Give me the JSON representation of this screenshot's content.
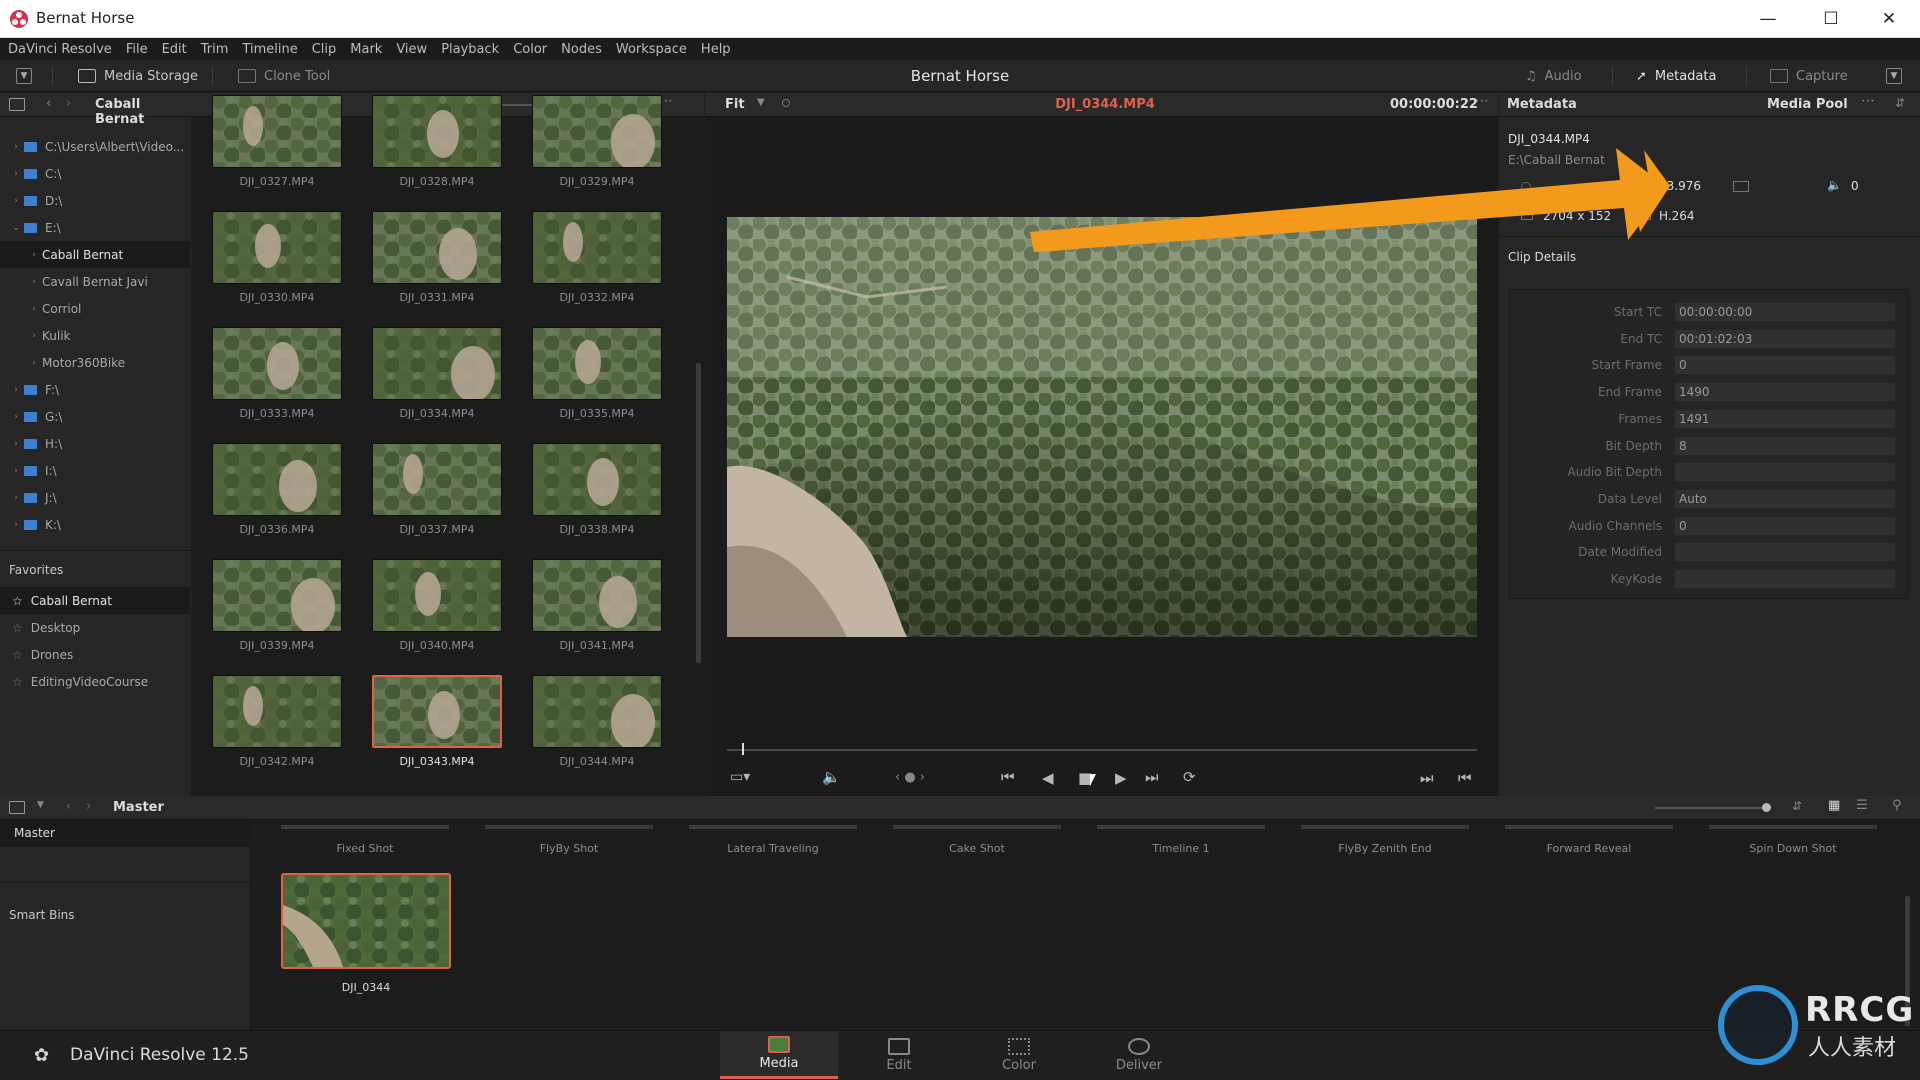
{
  "window": {
    "title": "Bernat Horse"
  },
  "menu": [
    "DaVinci Resolve",
    "File",
    "Edit",
    "Trim",
    "Timeline",
    "Clip",
    "Mark",
    "View",
    "Playback",
    "Color",
    "Nodes",
    "Workspace",
    "Help"
  ],
  "toolbar": {
    "media_storage": "Media Storage",
    "clone_tool": "Clone Tool",
    "project": "Bernat Horse",
    "audio": "Audio",
    "metadata": "Metadata",
    "capture": "Capture"
  },
  "browser": {
    "folder": "Caball Bernat",
    "tree": [
      {
        "label": "C:\\Users\\Albert\\Video...",
        "type": "drive"
      },
      {
        "label": "C:\\",
        "type": "drive"
      },
      {
        "label": "D:\\",
        "type": "drive"
      },
      {
        "label": "E:\\",
        "type": "drive",
        "open": true
      },
      {
        "label": "Caball Bernat",
        "type": "folder",
        "selected": true
      },
      {
        "label": "Cavall Bernat Javi",
        "type": "folder"
      },
      {
        "label": "Corriol",
        "type": "folder"
      },
      {
        "label": "Kulik",
        "type": "folder"
      },
      {
        "label": "Motor360Bike",
        "type": "folder"
      },
      {
        "label": "F:\\",
        "type": "drive"
      },
      {
        "label": "G:\\",
        "type": "drive"
      },
      {
        "label": "H:\\",
        "type": "drive"
      },
      {
        "label": "I:\\",
        "type": "drive"
      },
      {
        "label": "J:\\",
        "type": "drive"
      },
      {
        "label": "K:\\",
        "type": "drive"
      }
    ],
    "favorites_title": "Favorites",
    "favorites": [
      "Caball Bernat",
      "Desktop",
      "Drones",
      "EditingVideoCourse"
    ],
    "clips": [
      "DJI_0327.MP4",
      "DJI_0328.MP4",
      "DJI_0329.MP4",
      "DJI_0330.MP4",
      "DJI_0331.MP4",
      "DJI_0332.MP4",
      "DJI_0333.MP4",
      "DJI_0334.MP4",
      "DJI_0335.MP4",
      "DJI_0336.MP4",
      "DJI_0337.MP4",
      "DJI_0338.MP4",
      "DJI_0339.MP4",
      "DJI_0340.MP4",
      "DJI_0341.MP4",
      "DJI_0342.MP4",
      "DJI_0343.MP4",
      "DJI_0344.MP4"
    ],
    "selected_clip": "DJI_0343.MP4"
  },
  "viewer": {
    "zoom": "Fit",
    "clip_name": "DJI_0344.MP4",
    "timecode": "00:00:00:22",
    "playhead": 0.02
  },
  "metadata": {
    "title": "Metadata",
    "media_pool_tab": "Media Pool",
    "file": "DJI_0344.MP4",
    "path": "E:\\Caball Bernat",
    "fps": "23.976",
    "resolution": "2704 x 152",
    "codec": "H.264",
    "audio_ch": "0",
    "section": "Clip Details",
    "fields": [
      {
        "label": "Start TC",
        "value": "00:00:00:00"
      },
      {
        "label": "End TC",
        "value": "00:01:02:03"
      },
      {
        "label": "Start Frame",
        "value": "0"
      },
      {
        "label": "End Frame",
        "value": "1490"
      },
      {
        "label": "Frames",
        "value": "1491"
      },
      {
        "label": "Bit Depth",
        "value": "8"
      },
      {
        "label": "Audio Bit Depth",
        "value": ""
      },
      {
        "label": "Data Level",
        "value": "Auto"
      },
      {
        "label": "Audio Channels",
        "value": "0"
      },
      {
        "label": "Date Modified",
        "value": ""
      },
      {
        "label": "KeyKode",
        "value": ""
      }
    ]
  },
  "media_pool": {
    "bin": "Master",
    "bins": [
      "Master"
    ],
    "smart_bins": "Smart Bins",
    "bin_items": [
      "Fixed Shot",
      "FlyBy Shot",
      "Lateral Traveling",
      "Cake Shot",
      "Timeline 1",
      "FlyBy Zenith End",
      "Forward Reveal",
      "Spin Down Shot"
    ],
    "clip": "DJI_0344"
  },
  "app": {
    "name": "DaVinci Resolve 12.5"
  },
  "pages": [
    {
      "label": "Media",
      "active": true
    },
    {
      "label": "Edit"
    },
    {
      "label": "Color"
    },
    {
      "label": "Deliver"
    }
  ],
  "watermark": {
    "brand": "RRCG",
    "sub": "人人素材"
  },
  "colors": {
    "accent": "#e0614a",
    "annotation_arrow": "#f39a1c",
    "timecode_red": "#e0614a"
  }
}
